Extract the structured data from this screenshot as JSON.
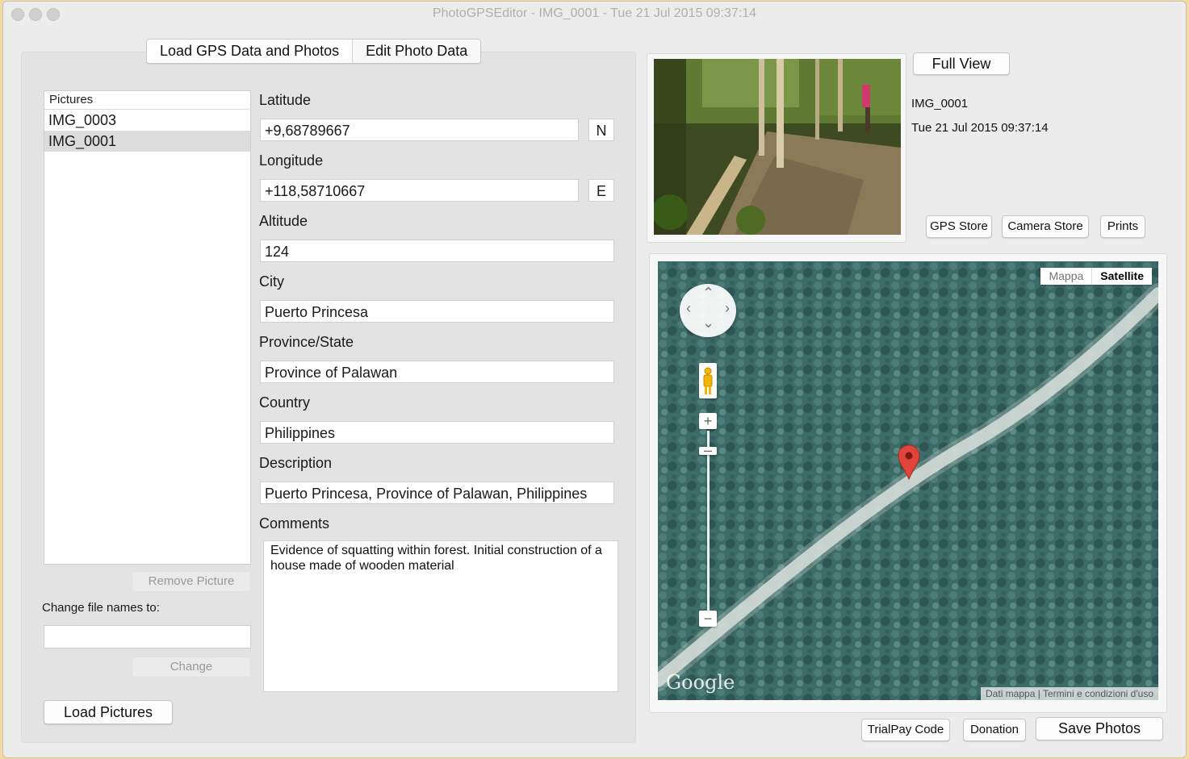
{
  "window": {
    "title": "PhotoGPSEditor - IMG_0001 - Tue 21 Jul 2015 09:37:14"
  },
  "tabs": {
    "load_label": "Load GPS Data and Photos",
    "edit_label": "Edit Photo Data"
  },
  "pictures": {
    "header": "Pictures",
    "items": [
      "IMG_0003",
      "IMG_0001"
    ],
    "selected": "IMG_0001",
    "remove_label": "Remove Picture",
    "change_names_label": "Change file names to:",
    "change_names_value": "",
    "change_label": "Change",
    "load_label": "Load Pictures"
  },
  "form": {
    "latitude_label": "Latitude",
    "latitude_value": "+9,68789667",
    "latitude_dir": "N",
    "longitude_label": "Longitude",
    "longitude_value": "+118,58710667",
    "longitude_dir": "E",
    "altitude_label": "Altitude",
    "altitude_value": "124",
    "city_label": "City",
    "city_value": "Puerto Princesa",
    "province_label": "Province/State",
    "province_value": "Province of Palawan",
    "country_label": "Country",
    "country_value": "Philippines",
    "description_label": "Description",
    "description_value": "Puerto Princesa, Province of Palawan, Philippines",
    "comments_label": "Comments",
    "comments_value": "Evidence of squatting within forest. Initial construction of a house made of wooden material"
  },
  "preview": {
    "full_view_label": "Full View",
    "filename": "IMG_0001",
    "datetime": "Tue 21 Jul 2015 09:37:14",
    "gps_store_label": "GPS Store",
    "camera_store_label": "Camera Store",
    "prints_label": "Prints"
  },
  "map": {
    "type_map_label": "Mappa",
    "type_satellite_label": "Satellite",
    "logo_text": "Google",
    "footer_data": "Dati mappa",
    "footer_terms": "Termini e condizioni d'uso"
  },
  "footer": {
    "trialpay_label": "TrialPay Code",
    "donation_label": "Donation",
    "save_label": "Save Photos"
  },
  "colors": {
    "desktop_background": "#f2dba3",
    "window_background": "#ececec",
    "marker_red": "#e0443a"
  }
}
